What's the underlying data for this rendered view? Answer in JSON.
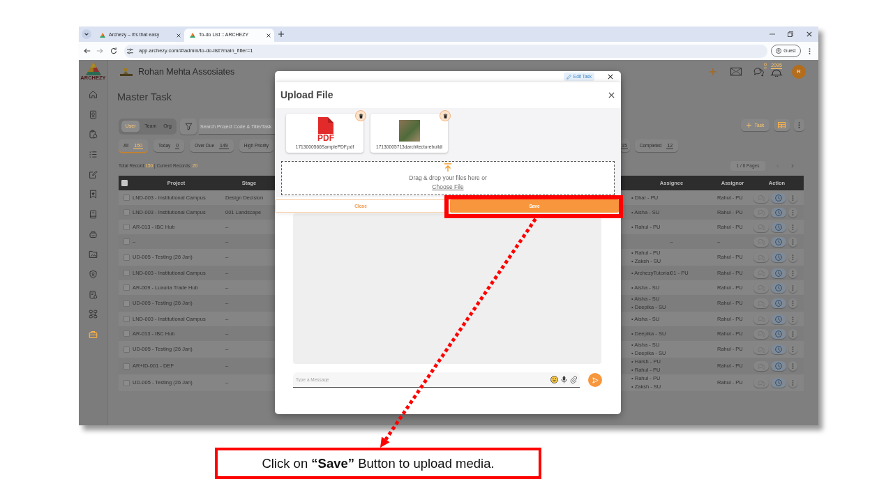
{
  "browser": {
    "tabs": [
      {
        "title": "Archezy – It's that easy",
        "selected": false
      },
      {
        "title": "To-do List :: ARCHEZY",
        "selected": true
      }
    ],
    "address": "app.archezy.com/#/admin/to-do-list?main_filter=1",
    "profile": "Guest"
  },
  "sidebar": {
    "logo_text": "ARCHEZY",
    "items": [
      {
        "selected": false
      },
      {
        "selected": false
      },
      {
        "selected": false
      },
      {
        "selected": false
      },
      {
        "selected": false
      },
      {
        "selected": false
      },
      {
        "selected": false
      },
      {
        "selected": false
      },
      {
        "selected": false
      },
      {
        "selected": false
      },
      {
        "selected": false
      },
      {
        "selected": false
      },
      {
        "selected": true
      }
    ]
  },
  "header": {
    "company": "Rohan Mehta Assosiates",
    "chat_count": "0",
    "notification_count": "2095",
    "avatar": "R"
  },
  "page_title": "Master Task",
  "scope": [
    {
      "label": "User",
      "selected": true
    },
    {
      "label": "Team",
      "selected": false
    },
    {
      "label": "Org",
      "selected": false
    }
  ],
  "search": {
    "placeholder": "Search Project Code & Title/Task"
  },
  "task_button": "Task",
  "filters": [
    {
      "label": "All",
      "count": "150",
      "selected": true
    },
    {
      "label": "Today",
      "count": "0",
      "selected": false
    },
    {
      "label": "Over Due",
      "count": "149",
      "selected": false
    },
    {
      "label": "High Priority",
      "selected": false
    },
    {
      "count": "15",
      "selected": false
    },
    {
      "label": "Completed",
      "count": "12",
      "selected": false
    }
  ],
  "records": {
    "total_label": "Total Record:",
    "total": "150",
    "current_label": "| Current Records:",
    "current": "20"
  },
  "pagination": "1 / 8 Pages",
  "table": {
    "select_all": false,
    "columns": [
      "Project",
      "Stage",
      "Assignee",
      "Assignor",
      "Action"
    ],
    "rows": [
      {
        "checked": false,
        "project": "LND-003 - Institutional Campus",
        "stage": "Design Decision",
        "assignees": [
          "• Dhar - PU"
        ],
        "assignor": "Rahul - PU"
      },
      {
        "checked": false,
        "project": "LND-003 - Institutional Campus",
        "stage": "001 Landscape",
        "assignees": [
          "• Aisha - SU"
        ],
        "assignor": "Rahul - PU"
      },
      {
        "checked": false,
        "project": "AR-013 - IBC Hub",
        "stage": "–",
        "assignees": [
          "• Rahul - PU"
        ],
        "assignor": "Rahul - PU"
      },
      {
        "checked": false,
        "project": "–",
        "stage": "–",
        "assignee": "–",
        "assignor": "–"
      },
      {
        "checked": false,
        "project": "UD-005 - Testing (26 Jan)",
        "stage": "–",
        "assignees": [
          "• Rahul - PU",
          "• Zaksh - SU"
        ],
        "assignor": "Rahul - PU"
      },
      {
        "checked": false,
        "project": "LND-003 - Institutional Campus",
        "stage": "–",
        "assignees": [
          "• ArchezyTutorial01 - PU"
        ],
        "assignor": "Rahul - PU"
      },
      {
        "checked": false,
        "project": "AR-009 - Luxuria Trade Hub",
        "stage": "–",
        "assignees": [
          "• Aisha - SU"
        ],
        "assignor": "Rahul - PU"
      },
      {
        "checked": false,
        "project": "UD-005 - Testing (26 Jan)",
        "stage": "–",
        "assignees": [
          "• Aisha - SU",
          "• Deepika - SU"
        ],
        "assignor": "Rahul - PU"
      },
      {
        "checked": false,
        "project": "LND-003 - Institutional Campus",
        "stage": "–",
        "assignees": [
          "• Aisha - SU"
        ],
        "assignor": "Rahul - PU"
      },
      {
        "checked": false,
        "project": "AR-013 - IBC Hub",
        "stage": "–",
        "assignees": [
          "• Deepika - SU"
        ],
        "assignor": "Rahul - PU"
      },
      {
        "checked": false,
        "project": "UD-005 - Testing (26 Jan)",
        "stage": "–",
        "assignees": [
          "• Aisha - SU",
          "• Deepika - SU"
        ],
        "assignor": "Rahul - PU"
      },
      {
        "checked": false,
        "project": "AR+ID-001 - DEF",
        "stage": "–",
        "assignees": [
          "• Harsh - PU",
          "• Rahul - PU"
        ],
        "assignor": "Rahul - PU"
      },
      {
        "checked": false,
        "project": "UD-005 - Testing (26 Jan)",
        "stage": "–",
        "assignees": [
          "• Rahul - PU",
          "• Zaksh - SU"
        ],
        "assignor": "Rahul - PU"
      }
    ]
  },
  "task_modal": {
    "edit_button": "Edit Task",
    "message_placeholder": "Type a Message"
  },
  "upload_modal": {
    "title": "Upload File",
    "files": [
      {
        "kind": "pdf",
        "icon_text": "PDF",
        "name": "1713000566SamplePDF.pdf"
      },
      {
        "kind": "image",
        "name": "17130005713darchitecturebuildi"
      }
    ],
    "drop_text": "Drag & drop your files here or",
    "choose_file": "Choose File",
    "buttons": [
      {
        "label": "Close",
        "kind": "secondary",
        "highlighted": false
      },
      {
        "label": "Save",
        "kind": "primary",
        "highlighted": true
      }
    ]
  },
  "instruction": "Click on **“Save”** Button to upload media."
}
